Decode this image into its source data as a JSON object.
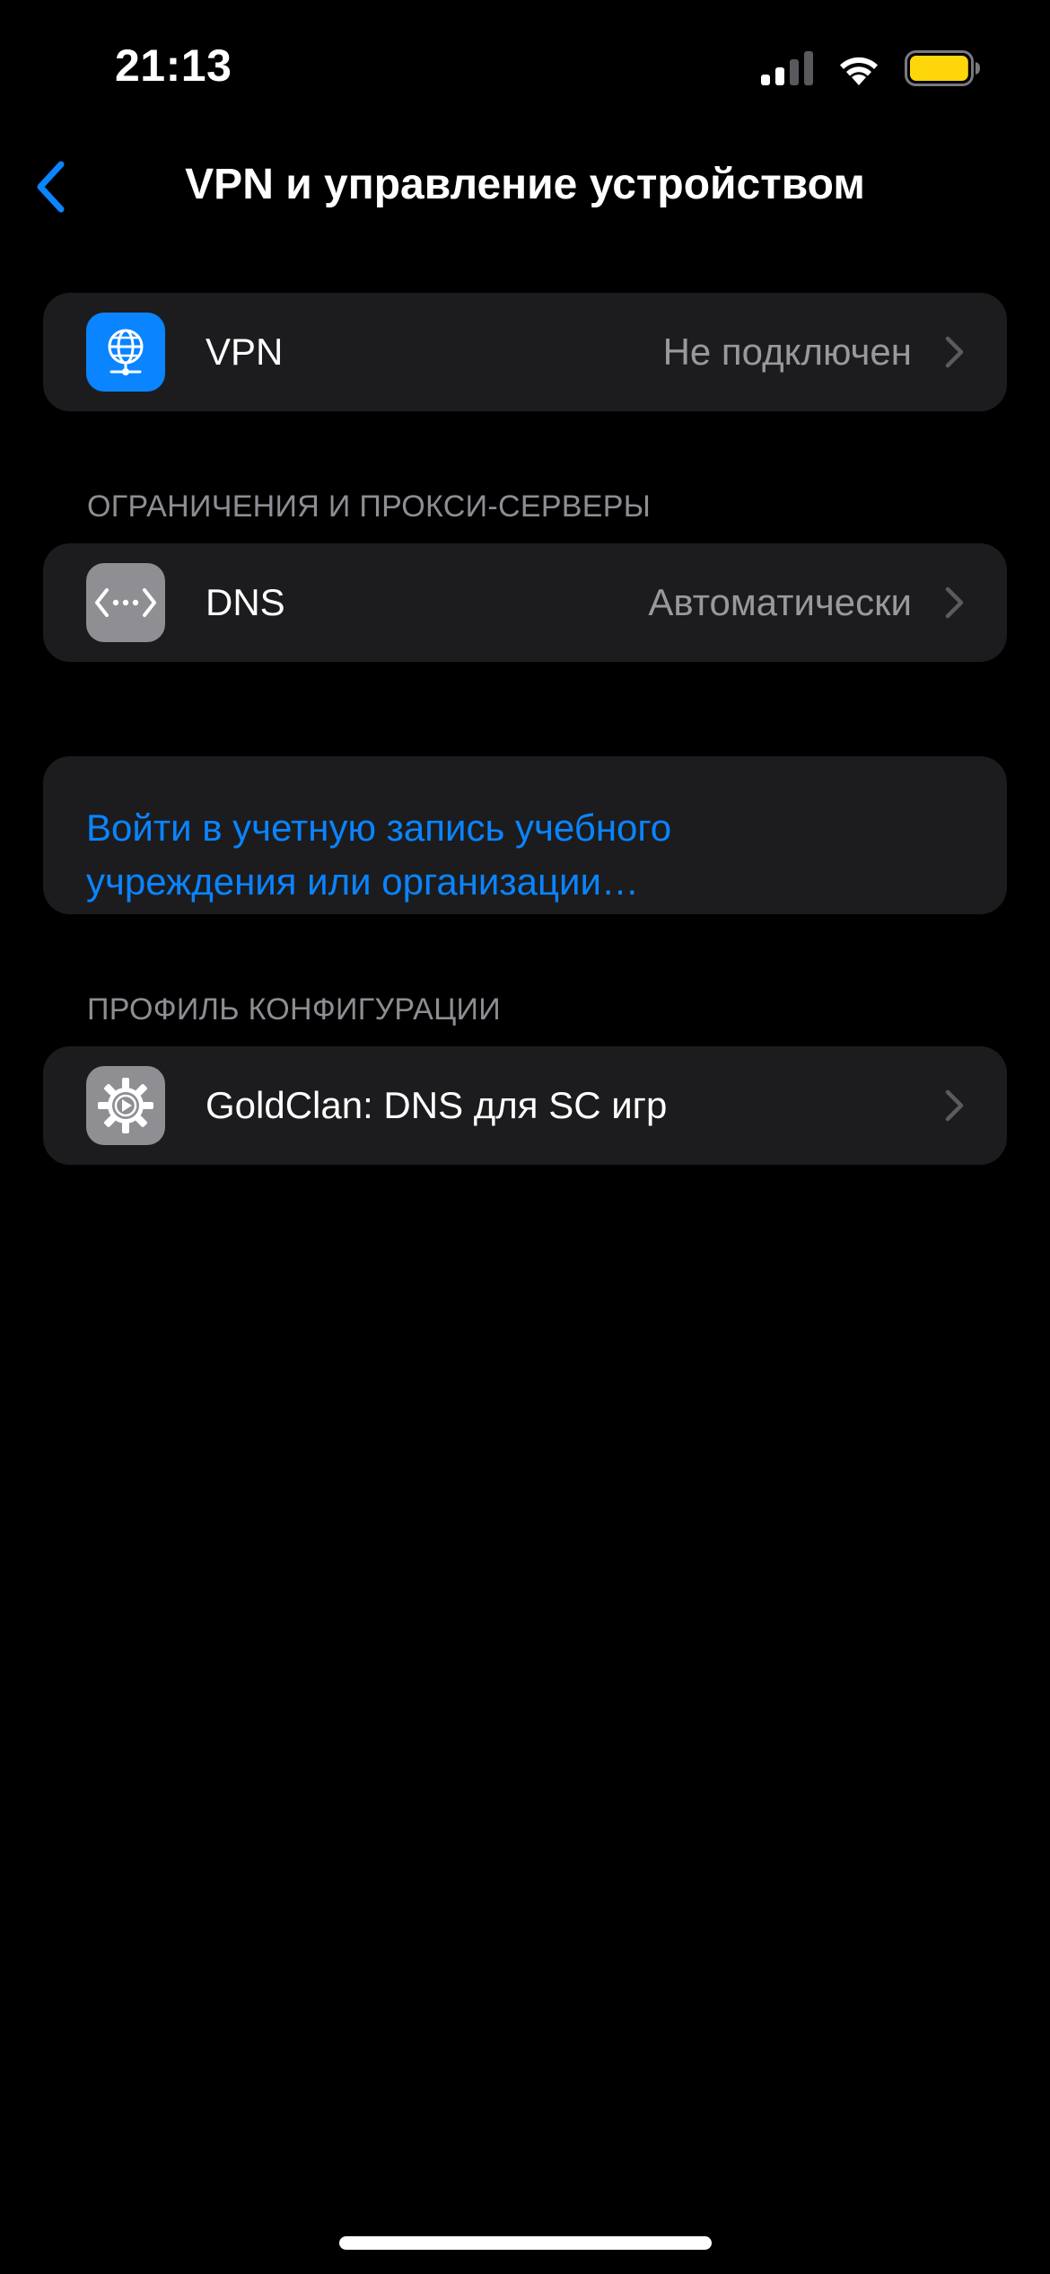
{
  "status_bar": {
    "time": "21:13",
    "signal_icon": "cellular-signal-icon",
    "wifi_icon": "wifi-icon",
    "battery_icon": "battery-icon",
    "battery_color": "#ffd60a",
    "battery_level": 0.9
  },
  "nav": {
    "back_icon": "chevron-left-icon",
    "title": "VPN и управление устройством"
  },
  "vpn_group": {
    "items": [
      {
        "label": "VPN",
        "value": "Не подключен",
        "icon": "vpn-globe-icon",
        "icon_color": "#0a84ff"
      }
    ]
  },
  "restrictions_section": {
    "header": "ОГРАНИЧЕНИЯ И ПРОКСИ-СЕРВЕРЫ",
    "items": [
      {
        "label": "DNS",
        "value": "Автоматически",
        "icon": "dns-arrows-icon",
        "icon_color": "#8e8e93"
      }
    ]
  },
  "sign_in": {
    "line1": "Войти в учетную запись учебного",
    "line2": "учреждения или организации…"
  },
  "profile_section": {
    "header": "ПРОФИЛЬ КОНФИГУРАЦИИ",
    "items": [
      {
        "label": "GoldClan: DNS для SC игр",
        "icon": "settings-gear-icon",
        "icon_color": "#8e8e93"
      }
    ]
  },
  "colors": {
    "background": "#000000",
    "group_background": "#1c1c1e",
    "accent": "#0a84ff",
    "secondary_text": "#98989f",
    "chevron": "#5a5a5f"
  }
}
